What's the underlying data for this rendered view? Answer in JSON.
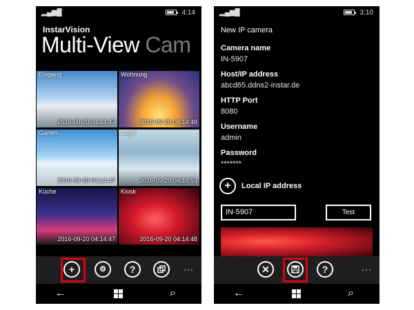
{
  "left_phone": {
    "status": {
      "signal": "▂▄▆█",
      "time": "4:14"
    },
    "app_title": "InstarVision",
    "pivot_active": "Multi-View",
    "pivot_next": "Cam",
    "cameras": [
      {
        "name": "Eingang",
        "timestamp": "2016-09-20 04:14:47"
      },
      {
        "name": "Wohnung",
        "timestamp": "2016-09-20 04:14:48"
      },
      {
        "name": "Garten",
        "timestamp": "2016-09-20 04:14:47"
      },
      {
        "name": "Lager",
        "timestamp": "2016-09-20 04:14:53"
      },
      {
        "name": "Küche",
        "timestamp": "2016-09-20 04:14:47"
      },
      {
        "name": "Kiosk",
        "timestamp": "2016-09-20 04:14:48"
      }
    ],
    "app_bar": {
      "add": "+",
      "settings": "⚙",
      "help": "?",
      "more": "···"
    }
  },
  "right_phone": {
    "status": {
      "signal": "▂▄▆█",
      "time": "3:10"
    },
    "page_title": "New IP camera",
    "fields": [
      {
        "label": "Camera name",
        "value": "IN-5907"
      },
      {
        "label": "Host/IP address",
        "value": "abcd65.ddns2-instar.de"
      },
      {
        "label": "HTTP Port",
        "value": "8080"
      },
      {
        "label": "Username",
        "value": "admin"
      },
      {
        "label": "Password",
        "value": "*******"
      }
    ],
    "local_ip_label": "Local IP address",
    "input_value": "IN-5907",
    "test_label": "Test",
    "app_bar": {
      "cancel": "✕",
      "help": "?",
      "more": "···"
    }
  },
  "nav": {
    "back": "←",
    "search": "⌕"
  },
  "colors": {
    "highlight": "#e0000f",
    "app_bar_bg": "#1f1f1f",
    "phone_bg": "#000000",
    "pivot_inactive": "#7a7a7a"
  }
}
